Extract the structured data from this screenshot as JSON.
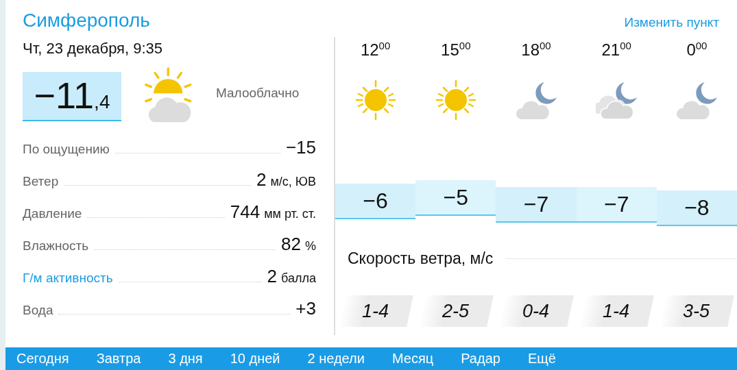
{
  "city": "Симферополь",
  "change_location": "Изменить пункт",
  "datetime": "Чт, 23 декабря, 9:35",
  "current": {
    "temp": "−11",
    "temp_fraction": ",4",
    "kind": "partly_cloudy",
    "condition": "Малооблачно"
  },
  "details": [
    {
      "label": "По ощущению",
      "value": "−15",
      "link": false
    },
    {
      "label": "Ветер",
      "value": "2",
      "unit": "м/с, ЮВ",
      "link": false
    },
    {
      "label": "Давление",
      "value": "744",
      "unit": "мм рт. ст.",
      "link": false
    },
    {
      "label": "Влажность",
      "value": "82",
      "unit": "%",
      "link": false
    },
    {
      "label": "Г/м активность",
      "value": "2",
      "unit": "балла",
      "link": true
    },
    {
      "label": "Вода",
      "value": "+3",
      "link": false
    }
  ],
  "hourly": [
    {
      "time": "12$^{00}$",
      "kind": "sun",
      "temp": "−6"
    },
    {
      "time": "15$^{00}$",
      "kind": "sun",
      "temp": "−5"
    },
    {
      "time": "18$^{00}$",
      "kind": "cloud_moon",
      "temp": "−7"
    },
    {
      "time": "21$^{00}$",
      "kind": "clouds_moon",
      "temp": "−7"
    },
    {
      "time": "0$^{00}$",
      "kind": "cloud_moon",
      "temp": "−8"
    }
  ],
  "wind_title": "Скорость ветра, м/с",
  "wind": [
    "1-4",
    "2-5",
    "0-4",
    "1-4",
    "3-5"
  ],
  "nav": [
    "Сегодня",
    "Завтра",
    "3 дня",
    "10 дней",
    "2 недели",
    "Месяц",
    "Радар",
    "Ещё"
  ]
}
